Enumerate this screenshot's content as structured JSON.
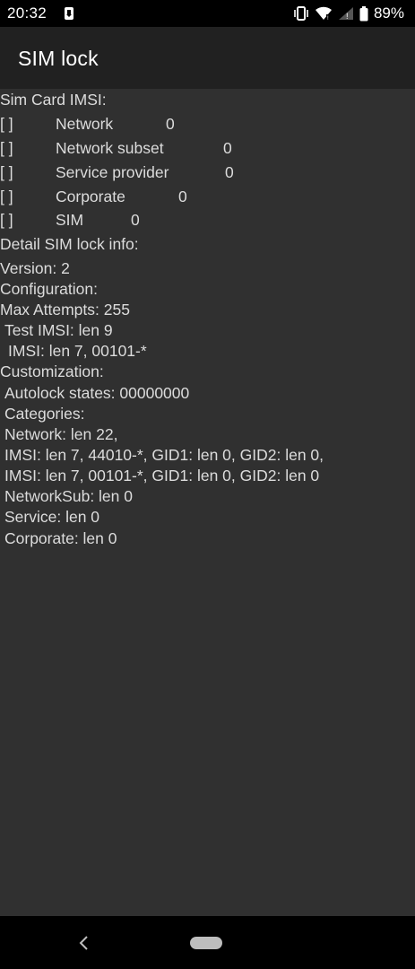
{
  "status_bar": {
    "time": "20:32",
    "battery_percent": "89%",
    "icons": [
      "download-notification-icon",
      "vibrate-icon",
      "wifi-icon",
      "cellular-signal-icon",
      "battery-icon"
    ]
  },
  "app_bar": {
    "title": "SIM lock"
  },
  "content": {
    "header": "Sim Card IMSI:",
    "lock_rows": [
      {
        "checkbox": "[ ]",
        "name": "Network",
        "count": "0"
      },
      {
        "checkbox": "[ ]",
        "name": "Network subset",
        "count": "0"
      },
      {
        "checkbox": "[ ]",
        "name": "Service provider",
        "count": "0"
      },
      {
        "checkbox": "[ ]",
        "name": "Corporate",
        "count": "0"
      },
      {
        "checkbox": "[ ]",
        "name": "SIM",
        "count": "0"
      }
    ],
    "detail_header": "Detail SIM lock info:",
    "detail_lines": [
      "Version: 2",
      "Configuration:",
      "Max Attempts: 255",
      " Test IMSI: len 9",
      "  IMSI: len 7, 00101-*",
      "Customization:",
      " Autolock states: 00000000",
      " Categories:",
      " Network: len 22,",
      " IMSI: len 7, 44010-*, GID1: len 0, GID2: len 0,",
      " IMSI: len 7, 00101-*, GID1: len 0, GID2: len 0",
      " NetworkSub: len 0",
      " Service: len 0",
      " Corporate: len 0"
    ]
  },
  "nav_bar": {
    "icons": [
      "back-icon",
      "home-pill-icon"
    ]
  }
}
